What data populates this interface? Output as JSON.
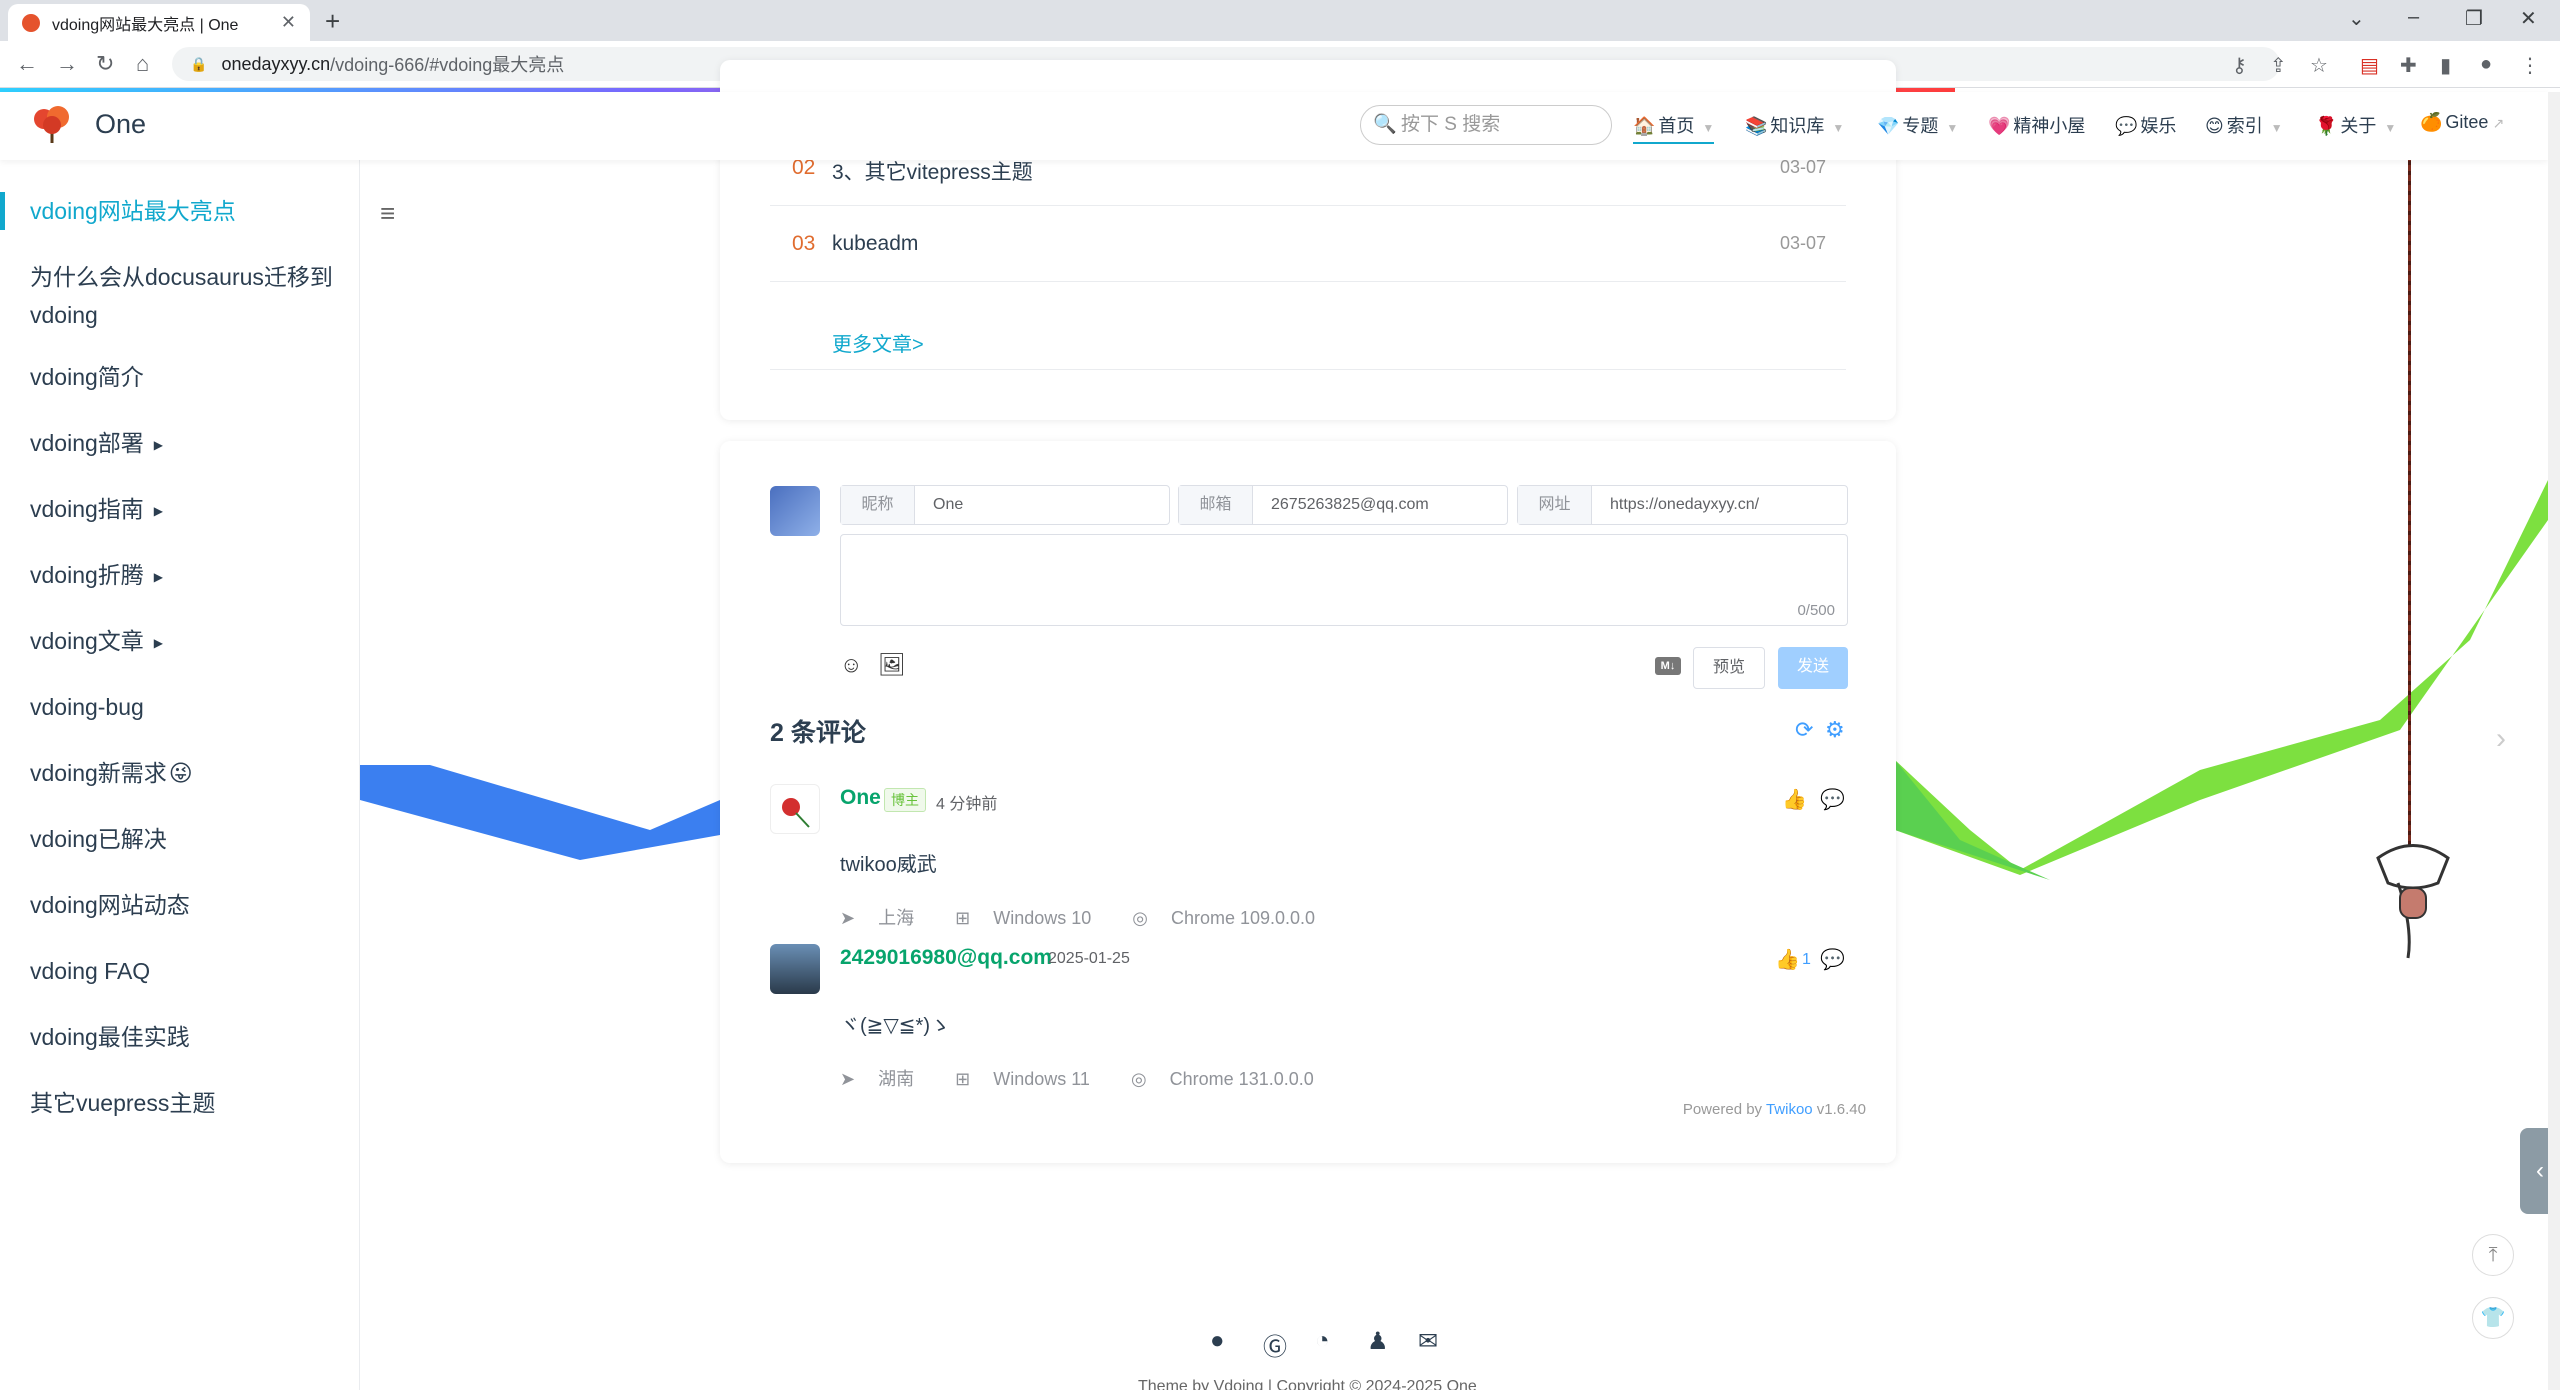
{
  "browser": {
    "tab_title": "vdoing网站最大亮点 | One",
    "url_host": "onedayxyy.cn",
    "url_path": "/vdoing-666/#vdoing最大亮点"
  },
  "site": {
    "name": "One",
    "search_placeholder": "按下 S 搜索",
    "nav": [
      {
        "label": "首页",
        "icon": "home-icon"
      },
      {
        "label": "知识库",
        "icon": "book-icon"
      },
      {
        "label": "专题",
        "icon": "gem-icon"
      },
      {
        "label": "精神小屋",
        "icon": "heart-icon"
      },
      {
        "label": "娱乐",
        "icon": "chat-icon"
      },
      {
        "label": "索引",
        "icon": "smile-icon"
      },
      {
        "label": "关于",
        "icon": "rose-icon"
      },
      {
        "label": "Gitee",
        "icon": "gitee-icon"
      }
    ]
  },
  "sidebar": {
    "items": [
      {
        "label": "vdoing网站最大亮点"
      },
      {
        "label": "为什么会从docusaurus迁移到"
      },
      {
        "label": "vdoing"
      },
      {
        "label": "vdoing简介"
      },
      {
        "label": "vdoing部署"
      },
      {
        "label": "vdoing指南"
      },
      {
        "label": "vdoing折腾"
      },
      {
        "label": "vdoing文章"
      },
      {
        "label": "vdoing-bug"
      },
      {
        "label": "vdoing新需求"
      },
      {
        "label": "vdoing已解决"
      },
      {
        "label": "vdoing网站动态"
      },
      {
        "label": "vdoing FAQ"
      },
      {
        "label": "vdoing最佳实践"
      },
      {
        "label": "其它vuepress主题"
      }
    ]
  },
  "recent": {
    "rows": [
      {
        "num": "02",
        "title": "3、其它vitepress主题",
        "date": "03-07"
      },
      {
        "num": "03",
        "title": "kubeadm",
        "date": "03-07"
      }
    ],
    "more": "更多文章>"
  },
  "comment_form": {
    "nick_label": "昵称",
    "nick_value": "One",
    "mail_label": "邮箱",
    "mail_value": "2675263825@qq.com",
    "url_label": "网址",
    "url_value": "https://onedayxyy.cn/",
    "counter": "0/500",
    "md_label": "M↓",
    "preview": "预览",
    "send": "发送"
  },
  "comments": {
    "count_label": "2 条评论",
    "items": [
      {
        "name": "One",
        "badge": "博主",
        "time": "4 分钟前",
        "text": "twikoo威武",
        "loc": "上海",
        "os": "Windows 10",
        "browser": "Chrome 109.0.0.0",
        "likes": ""
      },
      {
        "name": "2429016980@qq.com",
        "badge": "",
        "time": "2025-01-25",
        "text": "ヾ(≧▽≦*)ゝ",
        "loc": "湖南",
        "os": "Windows 11",
        "browser": "Chrome 131.0.0.0",
        "likes": "1"
      }
    ],
    "powered_prefix": "Powered by ",
    "powered_link": "Twikoo",
    "powered_version": " v1.6.40"
  },
  "footer": {
    "text": "Theme by Vdoing | Copyright © 2024-2025 One"
  },
  "colors": {
    "accent": "#11a8cd",
    "comment_name": "#07a46c",
    "link": "#409eff"
  }
}
